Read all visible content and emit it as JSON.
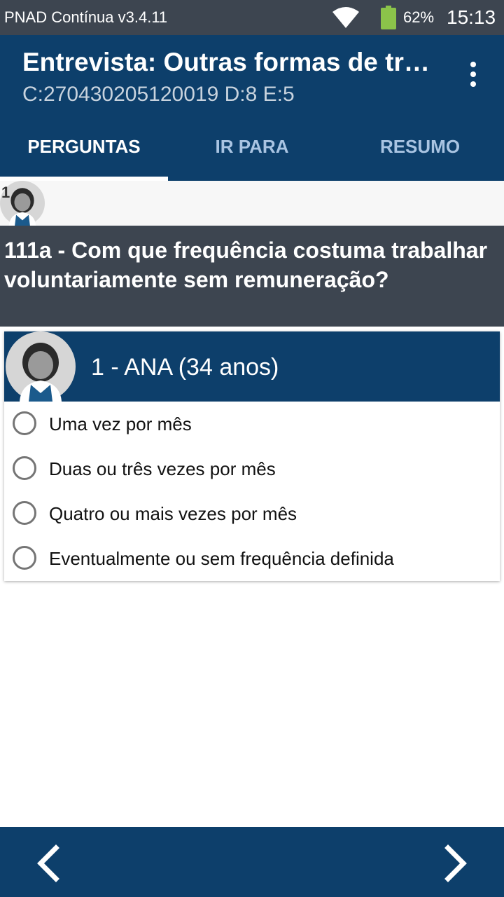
{
  "status_bar": {
    "app_name": "PNAD Contínua v3.4.11",
    "battery_percent": "62%",
    "time": "15:13",
    "battery_color": "#8bc34a"
  },
  "app_bar": {
    "title": "Entrevista: Outras formas de tr…",
    "subtitle": "C:270430205120019 D:8 E:5"
  },
  "tabs": [
    {
      "label": "PERGUNTAS",
      "active": true
    },
    {
      "label": "IR PARA",
      "active": false
    },
    {
      "label": "RESUMO",
      "active": false
    }
  ],
  "avatar_strip": {
    "number": "1"
  },
  "question": {
    "text": "111a - Com que frequência costuma trabalhar voluntariamente sem remuneração?"
  },
  "respondent": {
    "label": "1 - ANA (34 anos)"
  },
  "options": [
    {
      "label": "Uma vez por mês",
      "selected": false
    },
    {
      "label": "Duas ou três vezes por mês",
      "selected": false
    },
    {
      "label": "Quatro ou mais vezes por mês",
      "selected": false
    },
    {
      "label": "Eventualmente ou sem frequência definida",
      "selected": false
    }
  ],
  "colors": {
    "primary": "#0d3f6b",
    "status_bar": "#3d4550",
    "question_bg": "#3d4550"
  }
}
